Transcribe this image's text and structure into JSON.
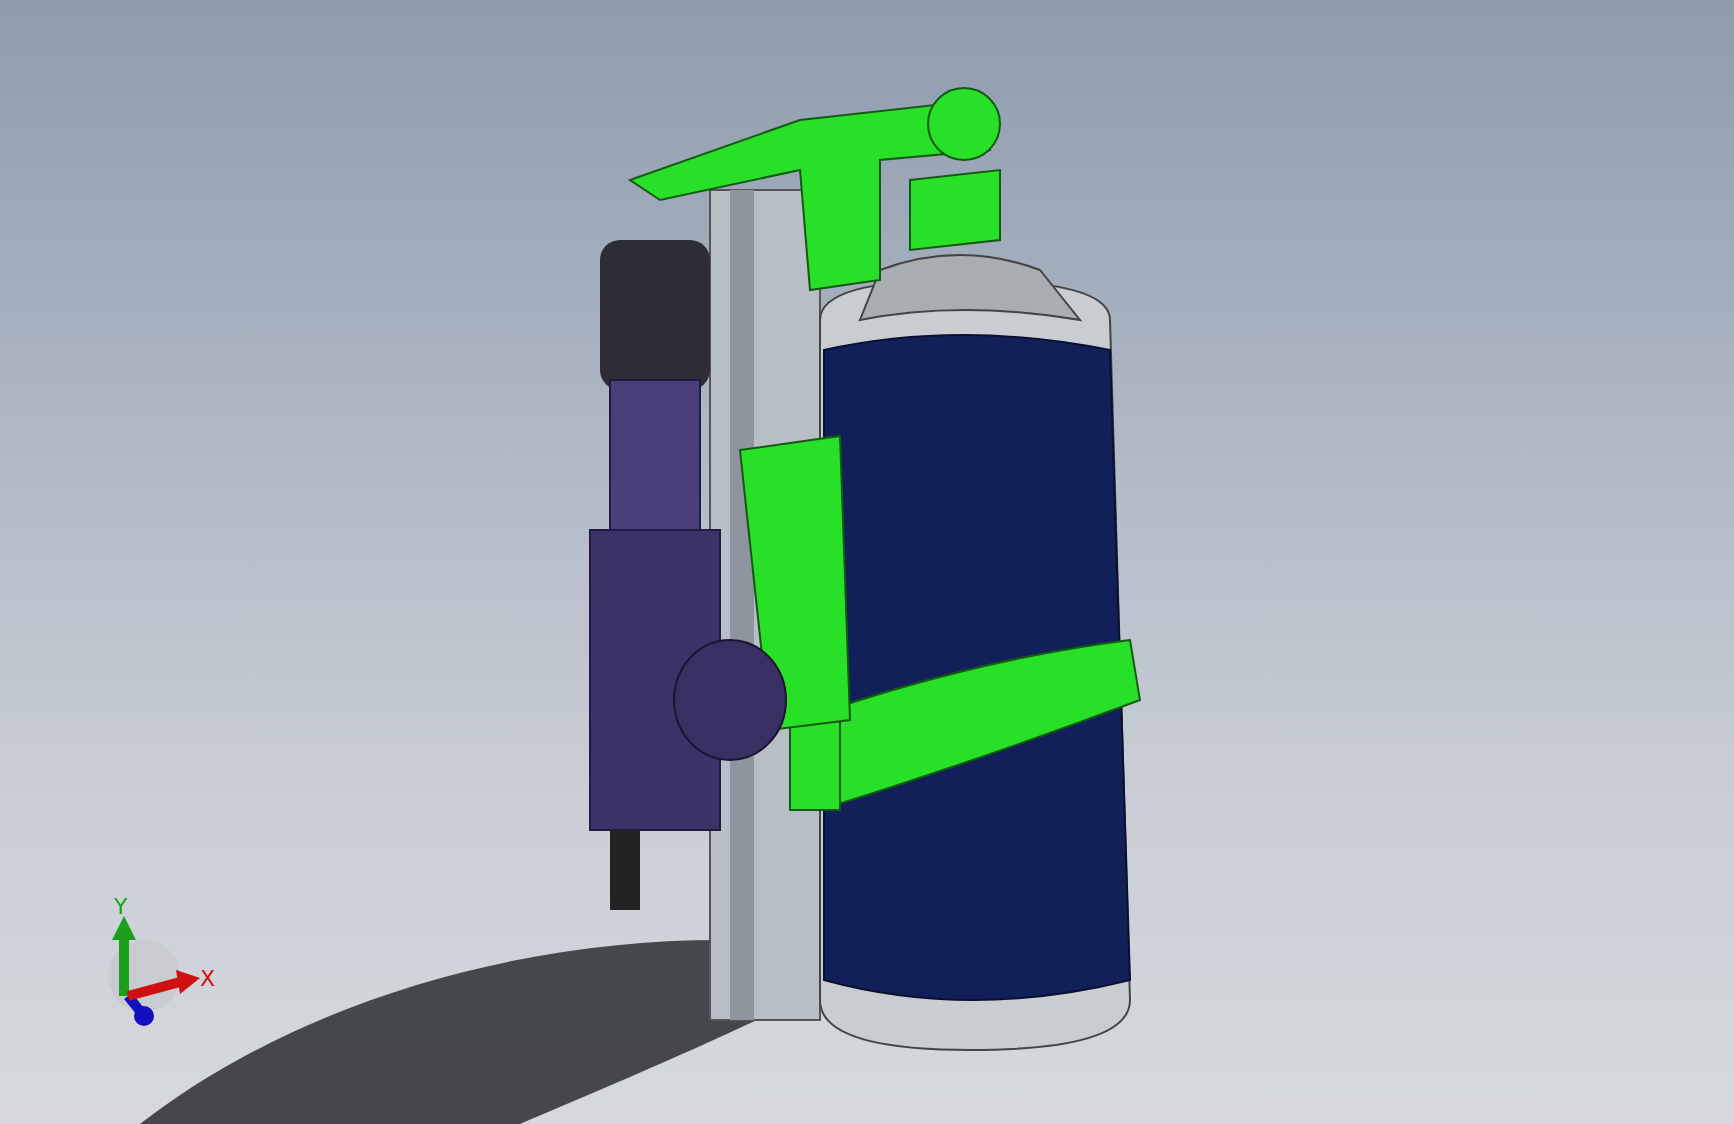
{
  "viewport": {
    "triad": {
      "axes": [
        {
          "label": "Y",
          "color": "#1aa01a",
          "kind": "vertical"
        },
        {
          "label": "X",
          "color": "#d01010",
          "kind": "horizontal"
        }
      ]
    }
  }
}
